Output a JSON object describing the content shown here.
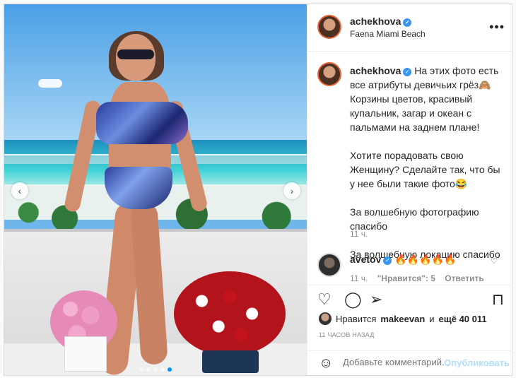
{
  "post": {
    "author": "achekhova",
    "location": "Faena Miami Beach",
    "more_icon": "more-horizontal-icon",
    "caption_text": "На этих фото есть все атрибуты девичьих грёз🙈\nКорзины цветов, красивый купальник, загар и океан с пальмами на заднем плане!\n\nХотите порадовать свою Женщину? Сделайте так, что бы у нее были такие фото😂\n\nЗа волшебную фотографию спасибо\n\nЗа волшебную локацию спасибо",
    "caption_time": "11 ч."
  },
  "comment": {
    "author": "avetov",
    "text": "🔥🔥🔥🔥🔥",
    "time": "11 ч.",
    "likes": "\"Нравится\": 5",
    "reply": "Ответить"
  },
  "actions": {
    "like_icon": "heart-icon",
    "comment_icon": "comment-bubble-icon",
    "share_icon": "paper-plane-icon",
    "save_icon": "bookmark-icon"
  },
  "likes": {
    "prefix": "Нравится",
    "user": "makeevan",
    "connector": "и",
    "count": "ещё 40 011"
  },
  "posted_ago": "11 ЧАСОВ НАЗАД",
  "comment_bar": {
    "placeholder": "Добавьте комментарий...",
    "publish": "Опубликовать"
  },
  "carousel": {
    "total": 5,
    "active_index": 4
  },
  "colors": {
    "accent": "#0095f6",
    "verified": "#3897f0",
    "muted": "#8e8e8e"
  }
}
